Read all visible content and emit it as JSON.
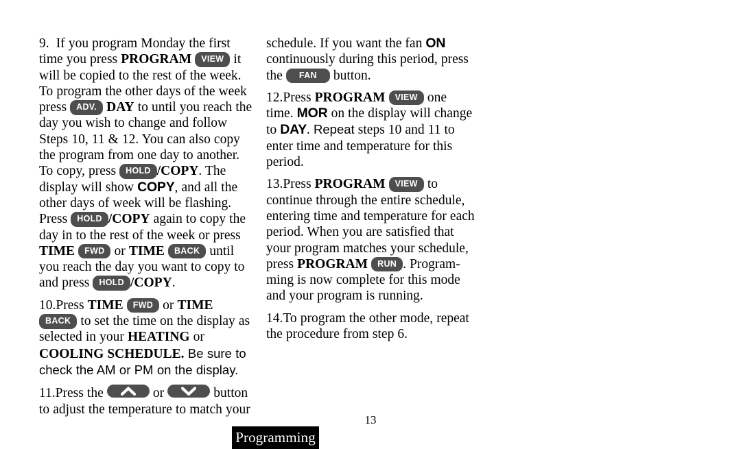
{
  "document": {
    "page_number": "13",
    "section_tab_label": "Programming",
    "accent_key_color": "#4e4e4e",
    "tab_background_color": "#000000",
    "page_background_color": "#ffffff"
  },
  "keys": {
    "view": "VIEW",
    "adv": "ADV.",
    "hold": "HOLD",
    "fwd": "FWD",
    "back": "BACK",
    "fan": "FAN",
    "run": "RUN",
    "arrow_up": "chevron-up",
    "arrow_down": "chevron-down"
  },
  "left_column": {
    "step9": {
      "number": "9.",
      "t1": "If you program Monday the first time you press ",
      "b1": "PROGRAM",
      "t2": " it will be copied to the rest of the week. To program the other days of the week press ",
      "b2": "DAY",
      "t3": " to until you reach the day you wish to change and follow Steps 10, 11 & 12. You can also copy the program from one day to another. To copy, press ",
      "b3": "/COPY",
      "t4": ". The display will show ",
      "lcd1": "COPY",
      "t5": ", and all the other days of week will be flashing. Press ",
      "b4": "/COPY",
      "t6": " again to copy the day in to the rest of the week or press ",
      "b5": "TIME",
      "t7": " or ",
      "b6": "TIME",
      "t8": " until you reach the day you want to copy to and press ",
      "b7": "/COPY",
      "t9": "."
    },
    "step10": {
      "number": "10.",
      "t1": "Press ",
      "b1": "TIME",
      "t2": " or ",
      "b2": "TIME",
      "t3": " to set the time on the display as selected in your ",
      "b3": "HEATING",
      "t4": " or ",
      "b4": "COOLING SCHEDULE.",
      "sans1": " Be sure to check the AM or PM on the display."
    },
    "step11": {
      "number": "11.",
      "t1": "Press the ",
      "t2": " or ",
      "t3": " button to adjust the temperature to match your"
    }
  },
  "right_column": {
    "continued": {
      "t1": "schedule. If you want the fan ",
      "lcd1": "ON",
      "t2": " continuously during this period, press the ",
      "t3": " button."
    },
    "step12": {
      "number": "12.",
      "t1": "Press ",
      "b1": "PROGRAM",
      "t2": " one time. ",
      "lcd1": "MOR",
      "t3": " on the display will change to ",
      "lcd2": "DAY",
      "t4": ". ",
      "sans1": "Repeat",
      "t5": " steps 10 and 11 to enter time and temperature for this period."
    },
    "step13": {
      "number": "13.",
      "t1": "Press ",
      "b1": "PROGRAM",
      "t2": " to continue through the entire schedule, entering time and temperature for each period. When you are satisfied that your program matches your schedule, press ",
      "b2": "PROGRAM",
      "t3": ". Program-ming is now complete for this mode and your program is running."
    },
    "step14": {
      "number": "14.",
      "t1": "To program the other mode, repeat the procedure from step 6."
    }
  }
}
